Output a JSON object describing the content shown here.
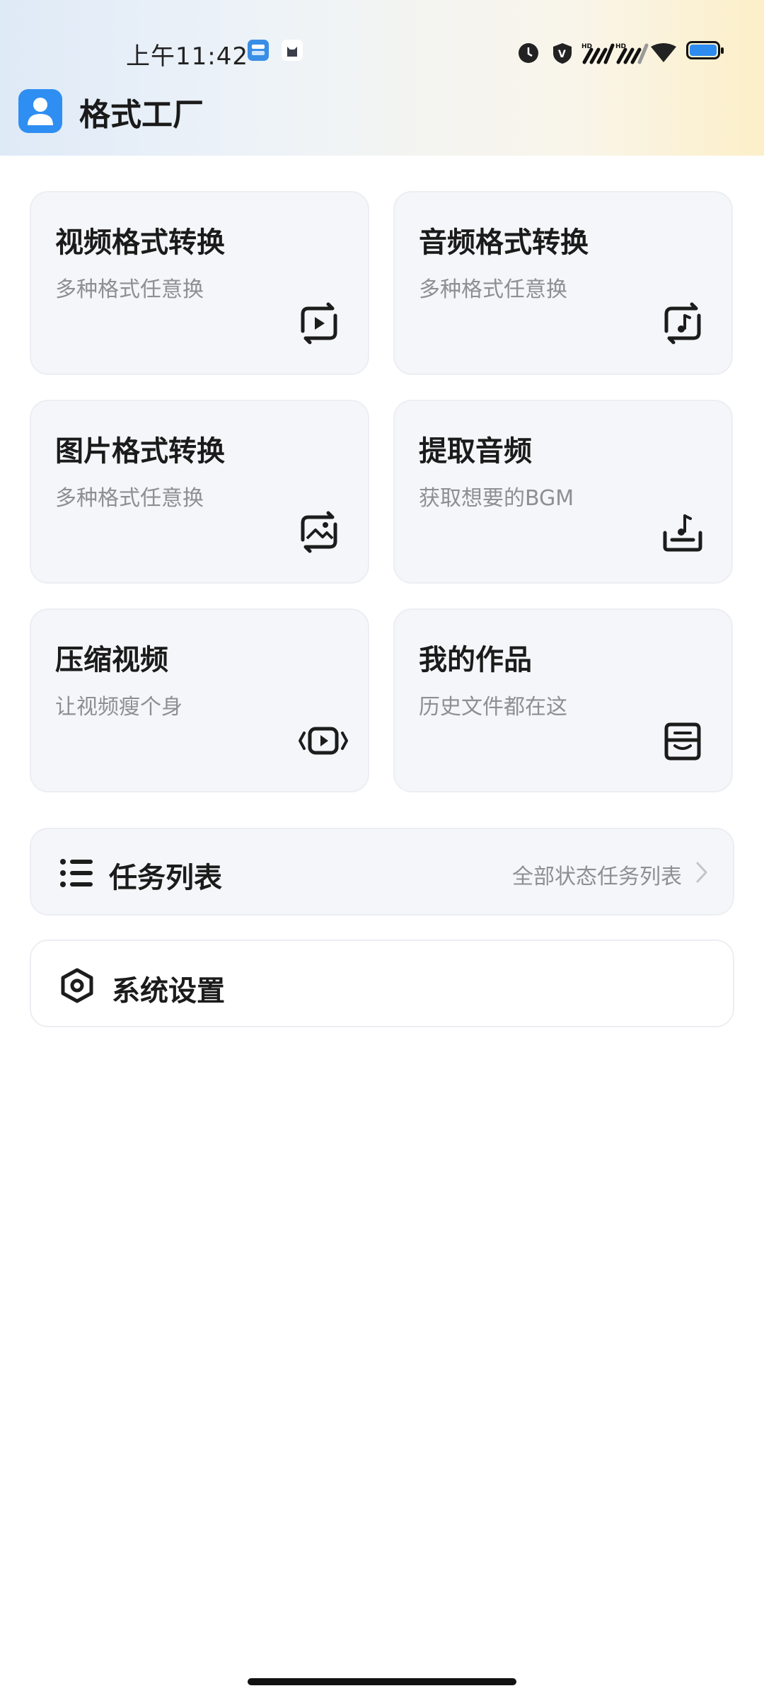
{
  "status_bar": {
    "time": "上午11:42"
  },
  "header": {
    "title": "格式工厂",
    "logo_icon": "user-profile-icon"
  },
  "cards": [
    {
      "title": "视频格式转换",
      "subtitle": "多种格式任意换",
      "icon": "video-convert-icon"
    },
    {
      "title": "音频格式转换",
      "subtitle": "多种格式任意换",
      "icon": "audio-convert-icon"
    },
    {
      "title": "图片格式转换",
      "subtitle": "多种格式任意换",
      "icon": "image-convert-icon"
    },
    {
      "title": "提取音频",
      "subtitle": "获取想要的BGM",
      "icon": "extract-audio-icon"
    },
    {
      "title": "压缩视频",
      "subtitle": "让视频瘦个身",
      "icon": "compress-video-icon"
    },
    {
      "title": "我的作品",
      "subtitle": "历史文件都在这",
      "icon": "my-works-icon"
    }
  ],
  "task_list": {
    "title": "任务列表",
    "right_text": "全部状态任务列表",
    "icon": "list-icon"
  },
  "settings": {
    "title": "系统设置",
    "icon": "settings-icon"
  },
  "colors": {
    "accent": "#2f8ef2",
    "battery": "#2e8bf0",
    "card_bg": "#f5f6f9",
    "subtitle": "#8d8f95"
  }
}
